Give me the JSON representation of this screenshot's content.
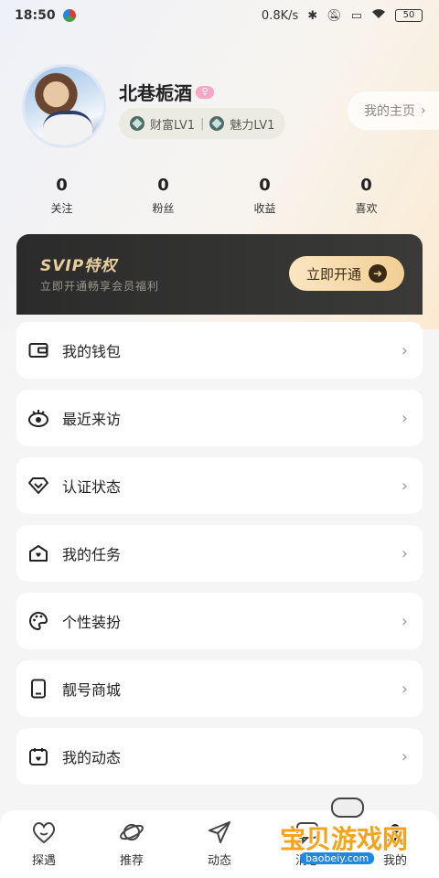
{
  "status_bar": {
    "time": "18:50",
    "net_speed": "0.8K/s",
    "battery": "50"
  },
  "profile": {
    "username": "北巷栀酒",
    "levels": [
      {
        "label": "财富LV1",
        "icon": "wealth-level-icon"
      },
      {
        "label": "魅力LV1",
        "icon": "charm-level-icon"
      }
    ],
    "homepage_label": "我的主页"
  },
  "stats": [
    {
      "value": "0",
      "label": "关注"
    },
    {
      "value": "0",
      "label": "粉丝"
    },
    {
      "value": "0",
      "label": "收益"
    },
    {
      "value": "0",
      "label": "喜欢"
    }
  ],
  "vip": {
    "title": "SVIP特权",
    "subtitle": "立即开通畅享会员福利",
    "button": "立即开通"
  },
  "menu": [
    {
      "label": "我的钱包",
      "icon": "wallet-icon"
    },
    {
      "label": "最近来访",
      "icon": "eye-icon"
    },
    {
      "label": "认证状态",
      "icon": "diamond-icon"
    },
    {
      "label": "我的任务",
      "icon": "task-icon"
    },
    {
      "label": "个性装扮",
      "icon": "palette-icon"
    },
    {
      "label": "靓号商城",
      "icon": "phone-icon"
    },
    {
      "label": "我的动态",
      "icon": "calendar-icon"
    }
  ],
  "nav": [
    {
      "label": "探遇",
      "icon": "heart-icon"
    },
    {
      "label": "推荐",
      "icon": "planet-icon"
    },
    {
      "label": "动态",
      "icon": "send-icon"
    },
    {
      "label": "消息",
      "icon": "message-icon"
    },
    {
      "label": "我的",
      "icon": "profile-icon"
    }
  ],
  "watermark": {
    "text": "宝贝游戏网",
    "url": "baobeiy.com"
  },
  "colors": {
    "vip_gold": "#e8cf9d",
    "vip_bg": "#2b2b2b",
    "watermark_orange": "#f6a21a"
  }
}
